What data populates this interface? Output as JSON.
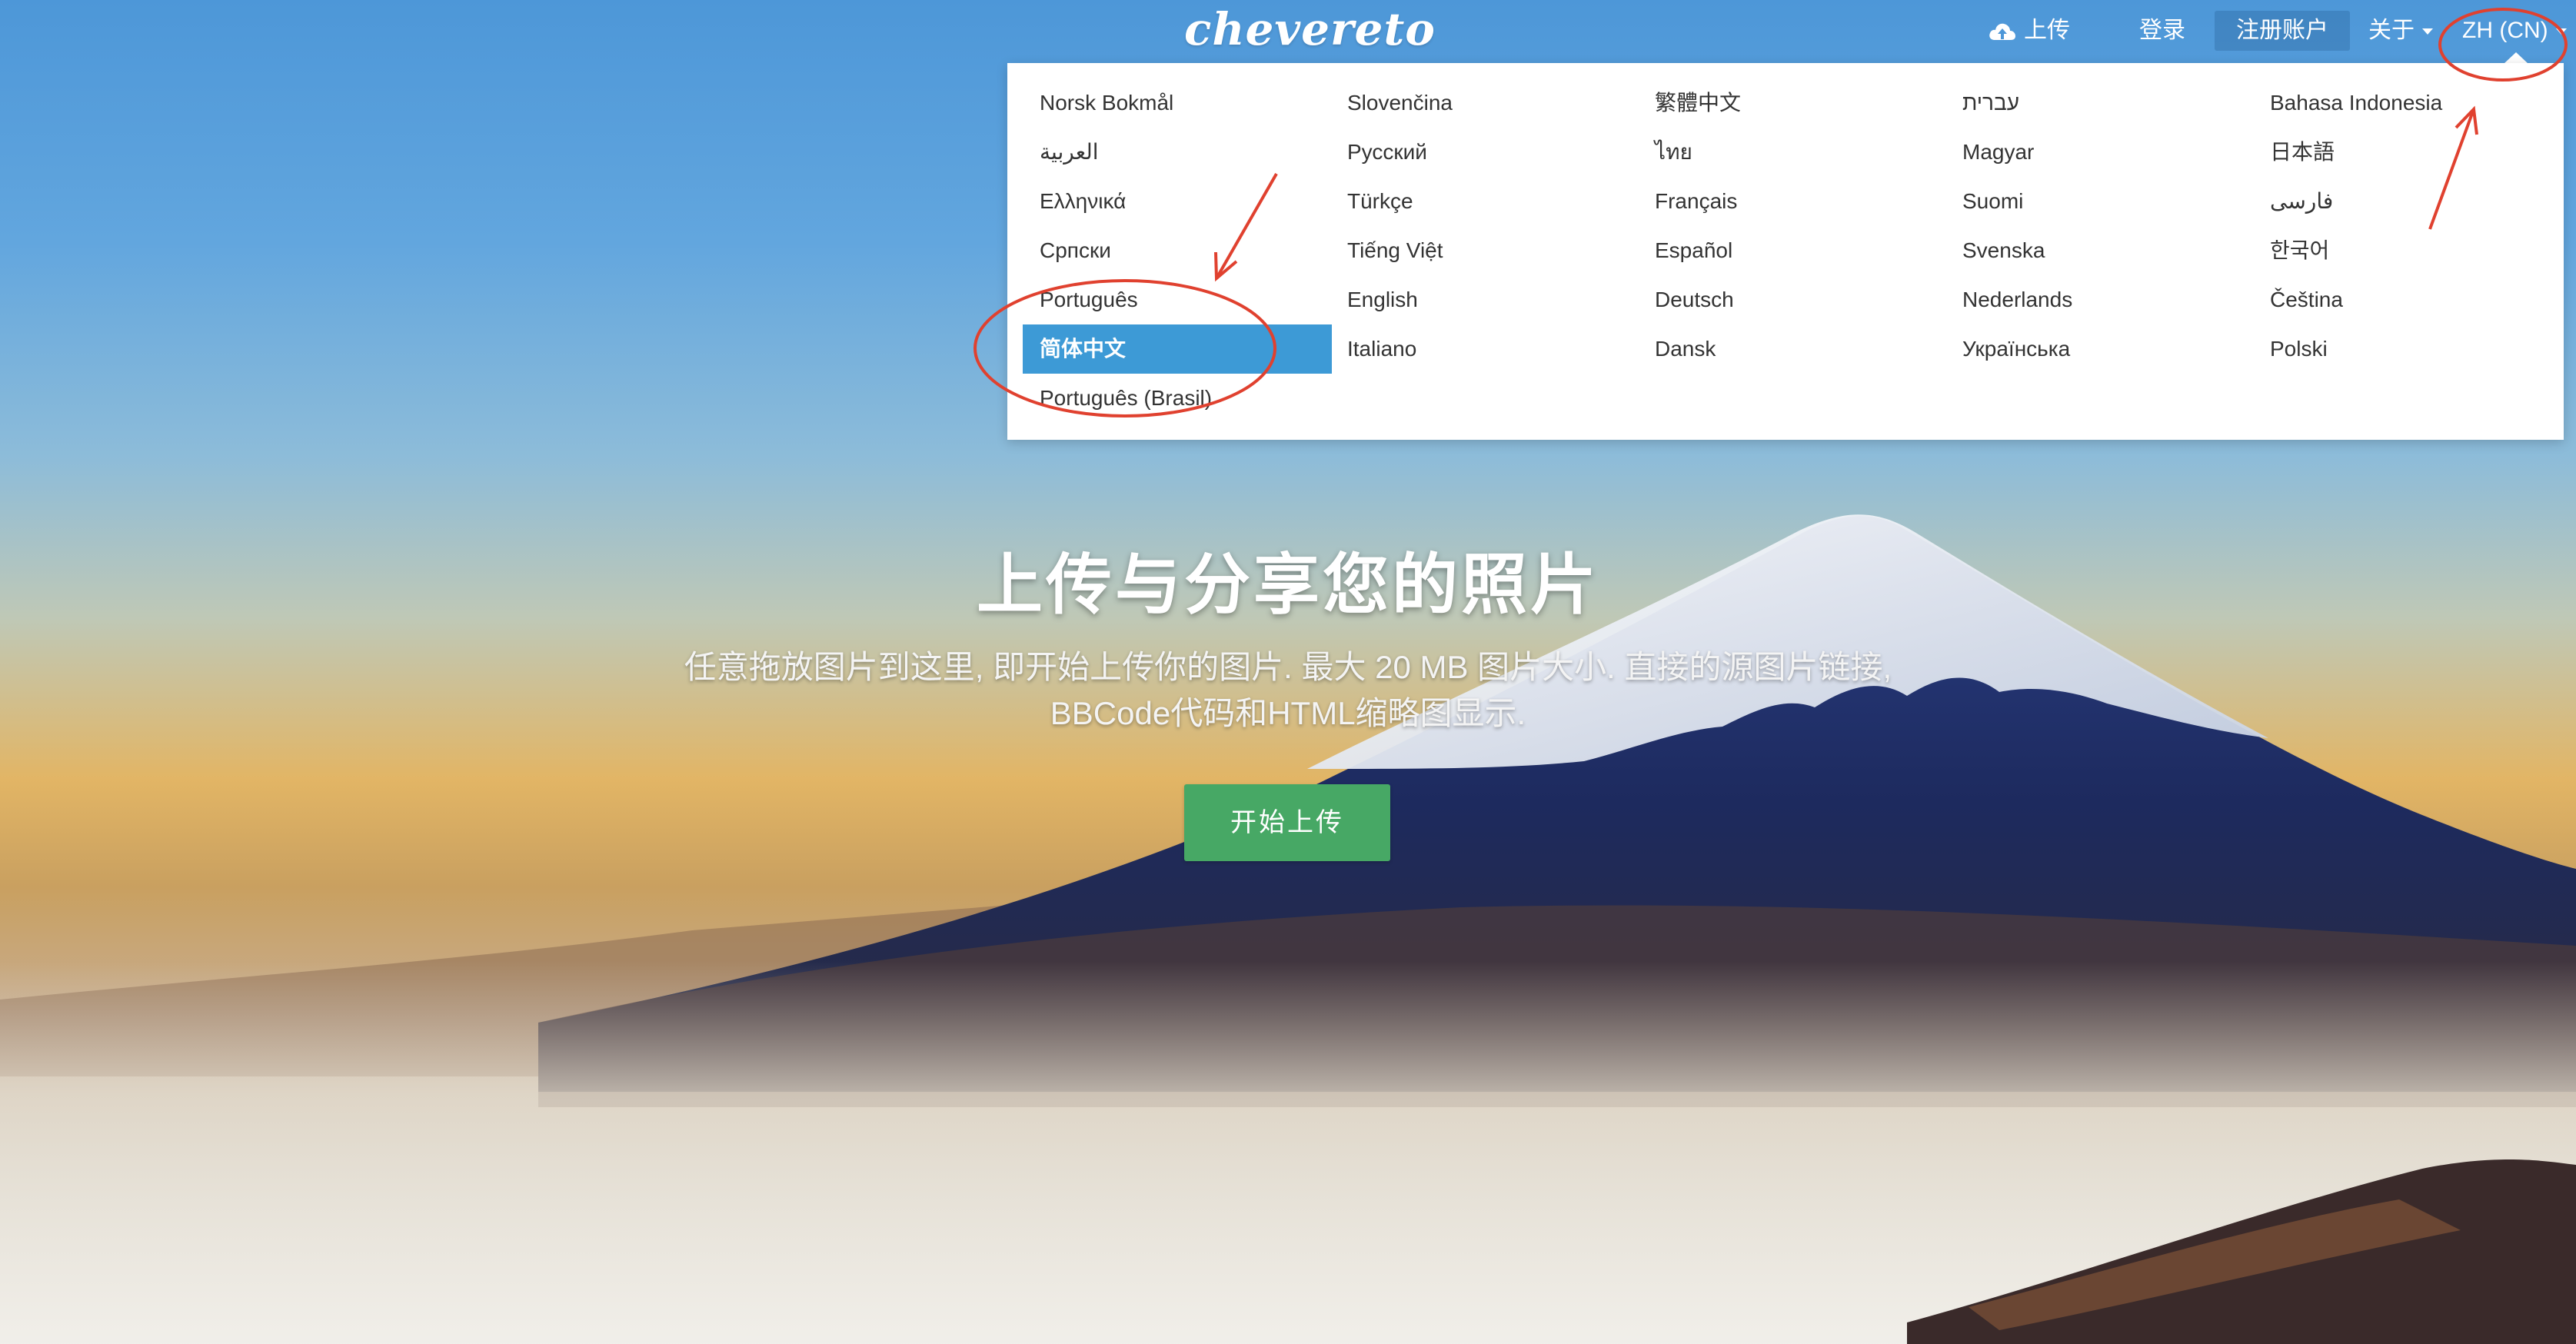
{
  "app": {
    "logo_text": "chevereto"
  },
  "nav": {
    "upload_label": "上传",
    "upload_icon": "cloud-upload-icon",
    "login_label": "登录",
    "signup_label": "注册账户",
    "about_label": "关于",
    "language_label": "ZH (CN)"
  },
  "language_menu": {
    "active": "简体中文",
    "columns": [
      [
        "Norsk Bokmål",
        "العربية",
        "Ελληνικά",
        "Српски",
        "Português",
        "简体中文",
        "Português (Brasil)"
      ],
      [
        "Slovenčina",
        "Русский",
        "Türkçe",
        "Tiếng Việt",
        "English",
        "Italiano"
      ],
      [
        "繁體中文",
        "ไทย",
        "Français",
        "Español",
        "Deutsch",
        "Dansk"
      ],
      [
        "עברית",
        "Magyar",
        "Suomi",
        "Svenska",
        "Nederlands",
        "Українська"
      ],
      [
        "Bahasa Indonesia",
        "日本語",
        "فارسی",
        "한국어",
        "Čeština",
        "Polski"
      ]
    ]
  },
  "hero": {
    "title": "上传与分享您的照片",
    "description": "任意拖放图片到这里, 即开始上传你的图片. 最大 20 MB 图片大小. 直接的源图片链接, BBCode代码和HTML缩略图显示.",
    "start_button": "开始上传"
  },
  "colors": {
    "sky_top": "#4d97d8",
    "horizon": "#e2b565",
    "mountain": "#1f2f66",
    "snow": "#f2f4f8",
    "active_item": "#3d9ad6",
    "start_button": "#47a865",
    "annotation": "#e0412f"
  }
}
